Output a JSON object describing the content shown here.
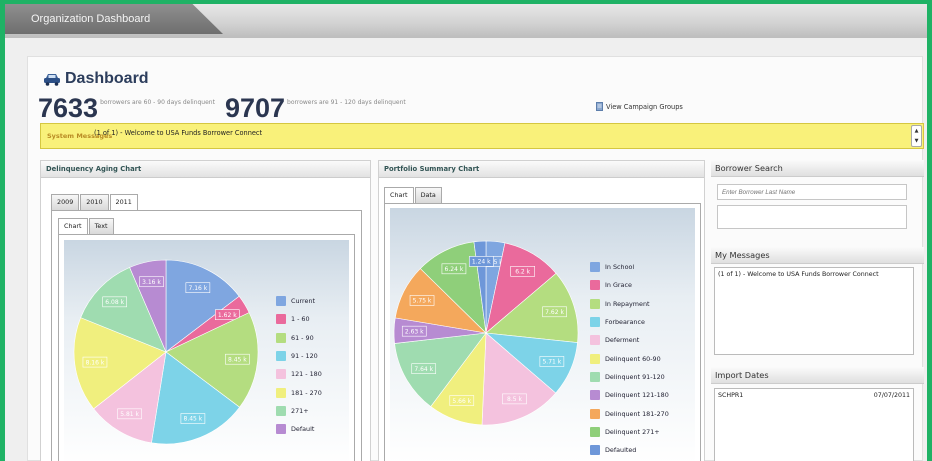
{
  "window": {
    "title": "Organization Dashboard"
  },
  "header": {
    "title": "Dashboard",
    "icon": "car-icon",
    "stat1": {
      "value": "7633",
      "text": "borrowers are 60 - 90 days delinquent"
    },
    "stat2": {
      "value": "9707",
      "text": "borrowers are 91 - 120 days delinquent"
    },
    "campaign_link": "View Campaign Groups"
  },
  "system_messages": {
    "label": "System Messages",
    "text": "(1 of 1) - Welcome to USA Funds Borrower Connect"
  },
  "delinquency_panel": {
    "title": "Delinquency Aging Chart",
    "year_tabs": [
      "2009",
      "2010",
      "2011"
    ],
    "active_year": "2011",
    "view_tabs": [
      "Chart",
      "Text"
    ]
  },
  "portfolio_panel": {
    "title": "Portfolio Summary Chart",
    "view_tabs": [
      "Chart",
      "Data"
    ]
  },
  "borrower_search": {
    "title": "Borrower Search",
    "placeholder": "Enter Borrower Last Name"
  },
  "my_messages": {
    "title": "My Messages",
    "text": "(1 of 1) - Welcome to USA Funds Borrower Connect"
  },
  "import_dates": {
    "title": "Import Dates",
    "rows": [
      {
        "name": "SCHPR1",
        "date": "07/07/2011"
      }
    ]
  },
  "chart_data": [
    {
      "type": "pie",
      "title": "Delinquency Aging Chart",
      "categories": [
        "Current",
        "1 - 60",
        "61 - 90",
        "91 - 120",
        "121 - 180",
        "181 - 270",
        "271+",
        "Default"
      ],
      "values": [
        7.16,
        1.62,
        8.45,
        8.45,
        5.81,
        8.16,
        6.08,
        3.16
      ],
      "labels": [
        "7.16 k",
        "1.62 k",
        "8.45 k",
        "8.45 k",
        "5.81 k",
        "8.16 k",
        "6.08 k",
        "3.16 k"
      ],
      "colors": [
        "#7fa6e0",
        "#ea6a9c",
        "#b4dd80",
        "#7dd3e8",
        "#f4c2de",
        "#f0ef7e",
        "#9fdcb0",
        "#b78bd2"
      ]
    },
    {
      "type": "pie",
      "title": "Portfolio Summary Chart",
      "categories": [
        "In School",
        "In Grace",
        "In Repayment",
        "Forbearance",
        "Deferment",
        "Delinquent 60-90",
        "Delinquent 91-120",
        "Delinquent 121-180",
        "Delinquent 181-270",
        "Delinquent 271+",
        "Defaulted"
      ],
      "values": [
        1.95,
        6.2,
        7.62,
        5.71,
        8.5,
        5.66,
        7.64,
        2.63,
        5.75,
        6.24,
        1.24
      ],
      "labels": [
        "1.95 k",
        "6.2 k",
        "7.62 k",
        "5.71 k",
        "8.5 k",
        "5.66 k",
        "7.64 k",
        "2.63 k",
        "5.75 k",
        "6.24 k",
        "1.24 k"
      ],
      "colors": [
        "#7fa6e0",
        "#ea6a9c",
        "#b4dd80",
        "#7dd3e8",
        "#f4c2de",
        "#f0ef7e",
        "#9fdcb0",
        "#b78bd2",
        "#f4a85c",
        "#8fcf7a",
        "#6e97d9"
      ]
    }
  ]
}
